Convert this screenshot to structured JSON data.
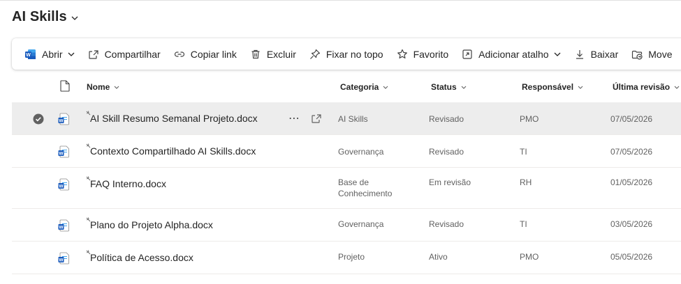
{
  "library": {
    "title": "AI Skills"
  },
  "toolbar": {
    "open": "Abrir",
    "share": "Compartilhar",
    "copy_link": "Copiar link",
    "delete": "Excluir",
    "pin": "Fixar no topo",
    "favorite": "Favorito",
    "add_shortcut": "Adicionar atalho",
    "download": "Baixar",
    "move": "Move"
  },
  "columns": {
    "name": "Nome",
    "category": "Categoria",
    "status": "Status",
    "owner": "Responsável",
    "last_revision": "Última revisão"
  },
  "rows": [
    {
      "name": "AI Skill Resumo Semanal Projeto.docx",
      "category": "AI Skills",
      "status": "Revisado",
      "owner": "PMO",
      "date": "07/05/2026",
      "selected": true
    },
    {
      "name": "Contexto Compartilhado AI Skills.docx",
      "category": "Governança",
      "status": "Revisado",
      "owner": "TI",
      "date": "07/05/2026",
      "selected": false
    },
    {
      "name": "FAQ Interno.docx",
      "category": "Base de Conhecimento",
      "status": "Em revisão",
      "owner": "RH",
      "date": "01/05/2026",
      "selected": false
    },
    {
      "name": "Plano do Projeto Alpha.docx",
      "category": "Governança",
      "status": "Revisado",
      "owner": "TI",
      "date": "03/05/2026",
      "selected": false
    },
    {
      "name": "Política de Acesso.docx",
      "category": "Projeto",
      "status": "Ativo",
      "owner": "PMO",
      "date": "05/05/2026",
      "selected": false
    }
  ],
  "colors": {
    "word_blue": "#185abd",
    "selected_row": "#ededed",
    "check_fill": "#616161"
  }
}
